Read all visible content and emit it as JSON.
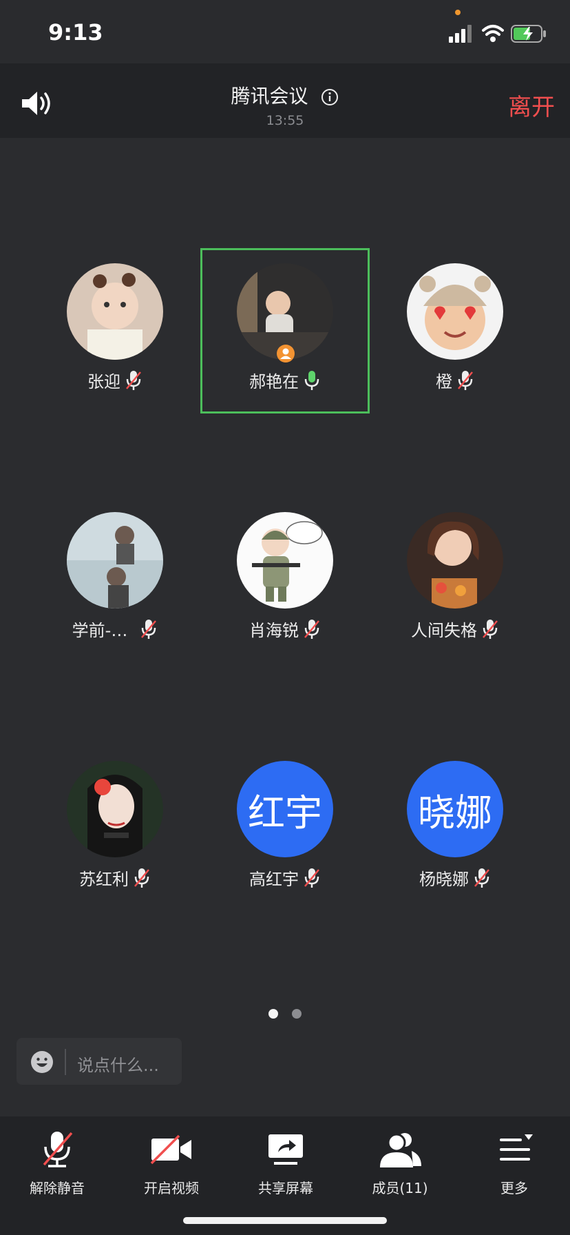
{
  "status_bar": {
    "time": "9:13"
  },
  "header": {
    "title": "腾讯会议",
    "elapsed": "13:55",
    "leave_label": "离开"
  },
  "participants": [
    {
      "name": "张迎",
      "avatar": "photo",
      "mic": "muted"
    },
    {
      "name": "郝艳在",
      "avatar": "photo",
      "mic": "active",
      "speaking": true,
      "host": true
    },
    {
      "name": "橙",
      "avatar": "memoji",
      "mic": "muted"
    },
    {
      "name": "学前-…",
      "avatar": "photo",
      "mic": "muted"
    },
    {
      "name": "肖海锐",
      "avatar": "cartoon",
      "mic": "muted"
    },
    {
      "name": "人间失格",
      "avatar": "photo",
      "mic": "muted"
    },
    {
      "name": "苏红利",
      "avatar": "illustration",
      "mic": "muted"
    },
    {
      "name": "高红宇",
      "avatar_text": "红宇",
      "mic": "muted"
    },
    {
      "name": "杨晓娜",
      "avatar_text": "晓娜",
      "mic": "muted"
    }
  ],
  "pagination": {
    "pages": 2,
    "current": 1
  },
  "chat": {
    "placeholder": "说点什么..."
  },
  "toolbar": {
    "unmute": "解除静音",
    "video": "开启视频",
    "share": "共享屏幕",
    "members": "成员(11)",
    "more": "更多"
  },
  "colors": {
    "accent_green": "#4cbe5b",
    "leave_red": "#f04e4e",
    "avatar_blue": "#2d6cf3",
    "host_orange": "#f39332"
  }
}
